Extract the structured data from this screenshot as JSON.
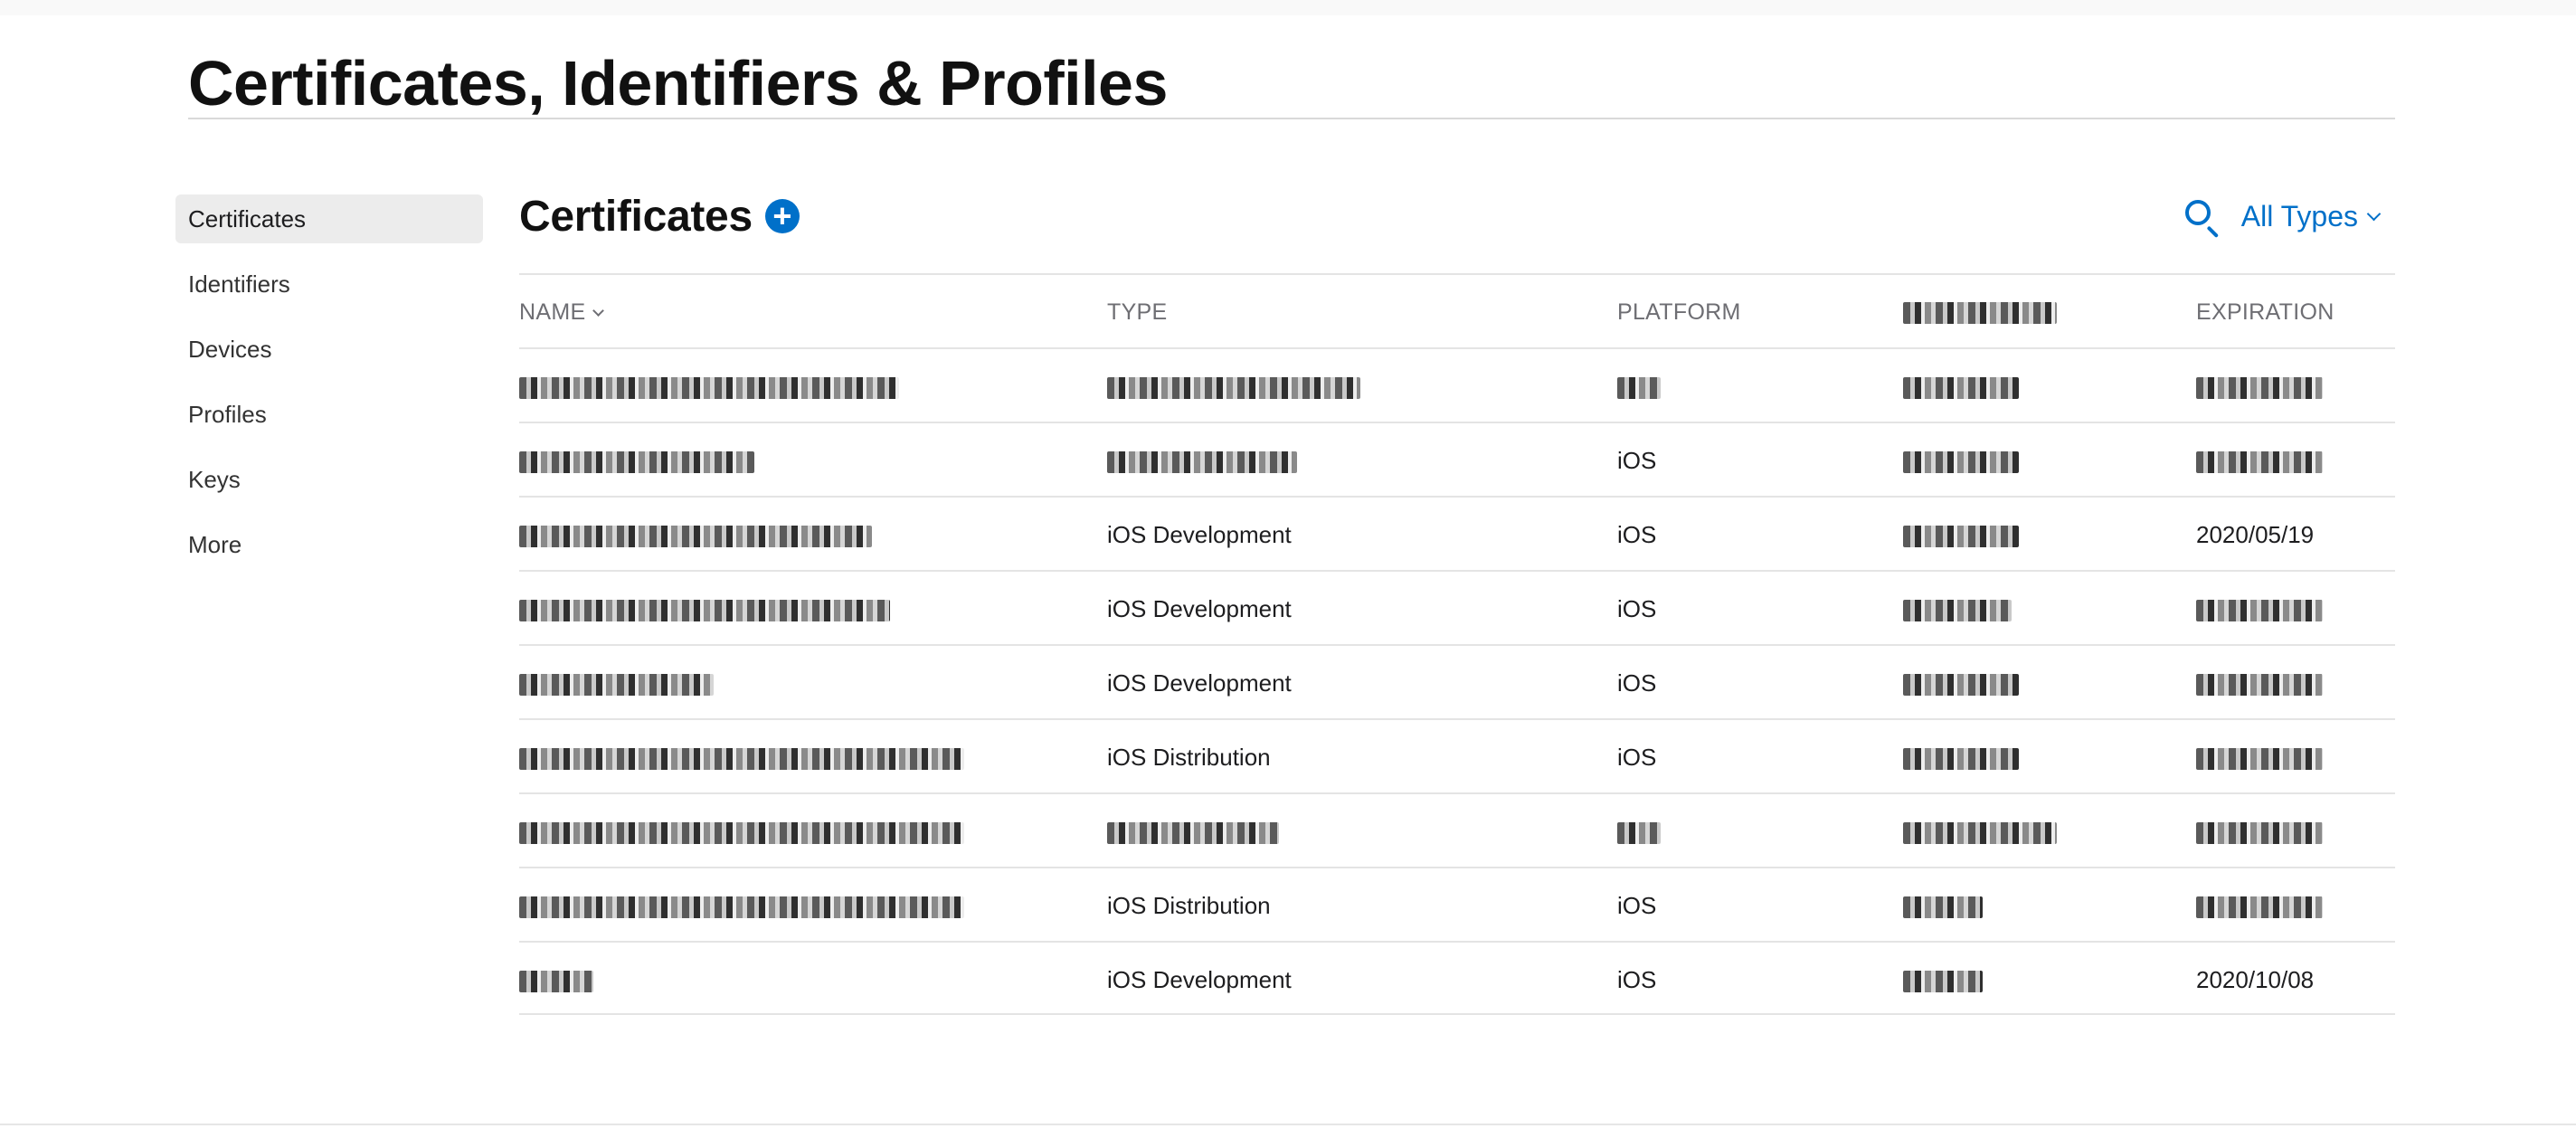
{
  "page": {
    "title": "Certificates, Identifiers & Profiles"
  },
  "sidebar": {
    "items": [
      {
        "label": "Certificates",
        "active": true
      },
      {
        "label": "Identifiers"
      },
      {
        "label": "Devices"
      },
      {
        "label": "Profiles"
      },
      {
        "label": "Keys"
      },
      {
        "label": "More"
      }
    ]
  },
  "section": {
    "title": "Certificates",
    "add_glyph": "+",
    "filter_label": "All Types",
    "icons": {
      "add": "plus-circle-icon",
      "search": "search-icon",
      "filter": "chevron-down-icon",
      "sort": "chevron-down-icon"
    }
  },
  "table": {
    "headers": {
      "name": "NAME",
      "type": "TYPE",
      "platform": "PLATFORM",
      "created_by": "",
      "expiration": "EXPIRATION"
    },
    "rows": [
      {
        "type": "",
        "platform": "",
        "expiration": ""
      },
      {
        "type": "",
        "platform": "iOS",
        "expiration": ""
      },
      {
        "type": "iOS Development",
        "platform": "iOS",
        "expiration": "2020/05/19"
      },
      {
        "type": "iOS Development",
        "platform": "iOS",
        "expiration": ""
      },
      {
        "type": "iOS Development",
        "platform": "iOS",
        "expiration": ""
      },
      {
        "type": "iOS Distribution",
        "platform": "iOS",
        "expiration": ""
      },
      {
        "type": "",
        "platform": "",
        "expiration": ""
      },
      {
        "type": "iOS Distribution",
        "platform": "iOS",
        "expiration": ""
      },
      {
        "type": "iOS Development",
        "platform": "iOS",
        "expiration": "2020/10/08"
      }
    ]
  },
  "colors": {
    "accent": "#0070c9",
    "text": "#1d1d1f",
    "muted": "#6e6e73",
    "rule": "#e4e4e4",
    "active_bg": "#ececec"
  }
}
